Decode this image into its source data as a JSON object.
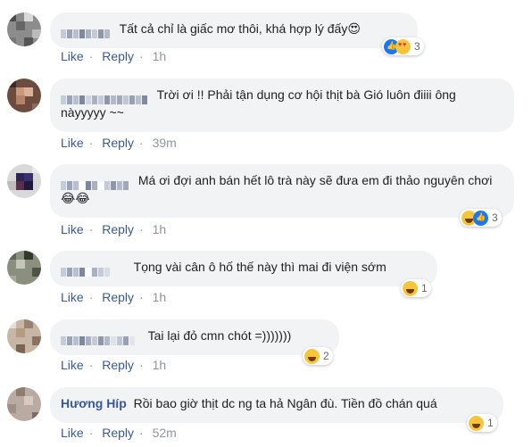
{
  "comments": [
    {
      "name": "",
      "text": "Tất cả chỉ là giấc mơ thôi, khá hợp lý đấy😍",
      "reactions": "3",
      "like": "Like",
      "reply": "Reply",
      "time": "1h",
      "sep": "·"
    },
    {
      "name": "",
      "text": "Trời ơi !! Phải tận dụng cơ hội thịt bà Gió luôn điiii ông nàyyyyy ~~",
      "reactions": "",
      "like": "Like",
      "reply": "Reply",
      "time": "39m",
      "sep": "·"
    },
    {
      "name": "",
      "text": "Má ơi đợi anh bán hết lô trà này sẽ đưa em đi thảo nguyên chơi 😂😂",
      "reactions": "3",
      "like": "Like",
      "reply": "Reply",
      "time": "1h",
      "sep": "·"
    },
    {
      "name": "",
      "text": "Tọng vài cân ô hố thế này thì mai đi viện sớm",
      "reactions": "1",
      "like": "Like",
      "reply": "Reply",
      "time": "1h",
      "sep": "·"
    },
    {
      "name": "",
      "text": "Tai lại đỏ cmn chót =)))))))",
      "reactions": "2",
      "like": "Like",
      "reply": "Reply",
      "time": "1h",
      "sep": "·"
    },
    {
      "name": "Hương Híp",
      "text": "Rồi bao giờ thịt dc ng ta hả Ngân đù. Tiền đồ chán quá",
      "reactions": "1",
      "like": "Like",
      "reply": "Reply",
      "time": "52m",
      "sep": "·"
    }
  ],
  "colors": {
    "link": "#385898",
    "bubble": "#f2f3f5",
    "meta": "#90949c"
  },
  "icons": [
    "like-icon",
    "haha-icon",
    "love-icon"
  ]
}
